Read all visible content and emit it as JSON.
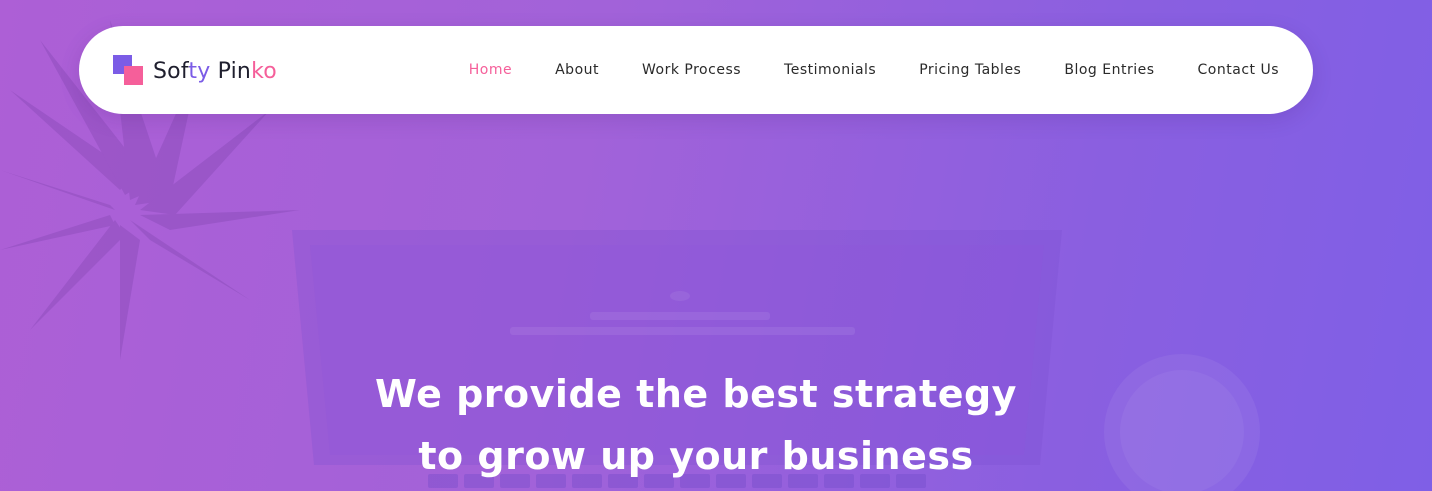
{
  "brand": {
    "parts": [
      "Sof",
      "ty",
      " Pin",
      "ko"
    ],
    "colors": {
      "primary": "#7b5ce6",
      "accent": "#f55f9a",
      "text": "#1f1f2e"
    }
  },
  "nav": {
    "items": [
      {
        "label": "Home",
        "active": true
      },
      {
        "label": "About",
        "active": false
      },
      {
        "label": "Work Process",
        "active": false
      },
      {
        "label": "Testimonials",
        "active": false
      },
      {
        "label": "Pricing Tables",
        "active": false
      },
      {
        "label": "Blog Entries",
        "active": false
      },
      {
        "label": "Contact Us",
        "active": false
      }
    ]
  },
  "hero": {
    "line1_pre": "We provide the best ",
    "line1_bold": "strategy",
    "line2_pre": "to grow up your ",
    "line2_bold": "business",
    "gradient": [
      "#ad5fd6",
      "#7f5fe6"
    ]
  }
}
